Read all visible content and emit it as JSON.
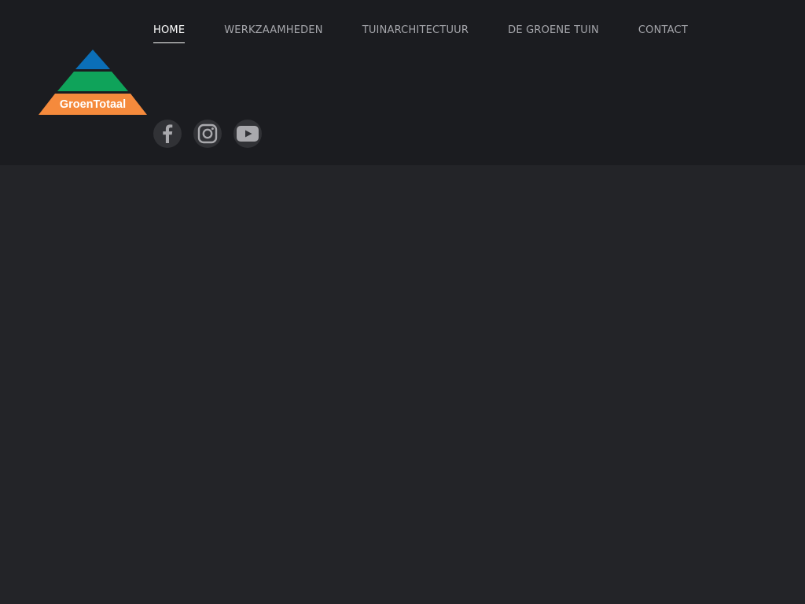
{
  "brand": {
    "logo_text": "GroenTotaal",
    "colors": {
      "top": "#0b6fb8",
      "middle": "#0fa35a",
      "bottom": "#f58a3c"
    }
  },
  "nav": {
    "items": [
      {
        "label": "HOME",
        "active": true
      },
      {
        "label": "WERKZAAMHEDEN",
        "active": false
      },
      {
        "label": "TUINARCHITECTUUR",
        "active": false
      },
      {
        "label": "DE GROENE TUIN",
        "active": false
      },
      {
        "label": "CONTACT",
        "active": false
      }
    ]
  },
  "social": {
    "items": [
      {
        "icon": "facebook-icon"
      },
      {
        "icon": "instagram-icon"
      },
      {
        "icon": "youtube-icon"
      }
    ]
  },
  "theme": {
    "header_bg": "#1b1c20",
    "page_bg": "#232428",
    "nav_text": "#a6a7ac",
    "nav_active": "#ffffff",
    "icon_color": "#a9a9ad"
  }
}
